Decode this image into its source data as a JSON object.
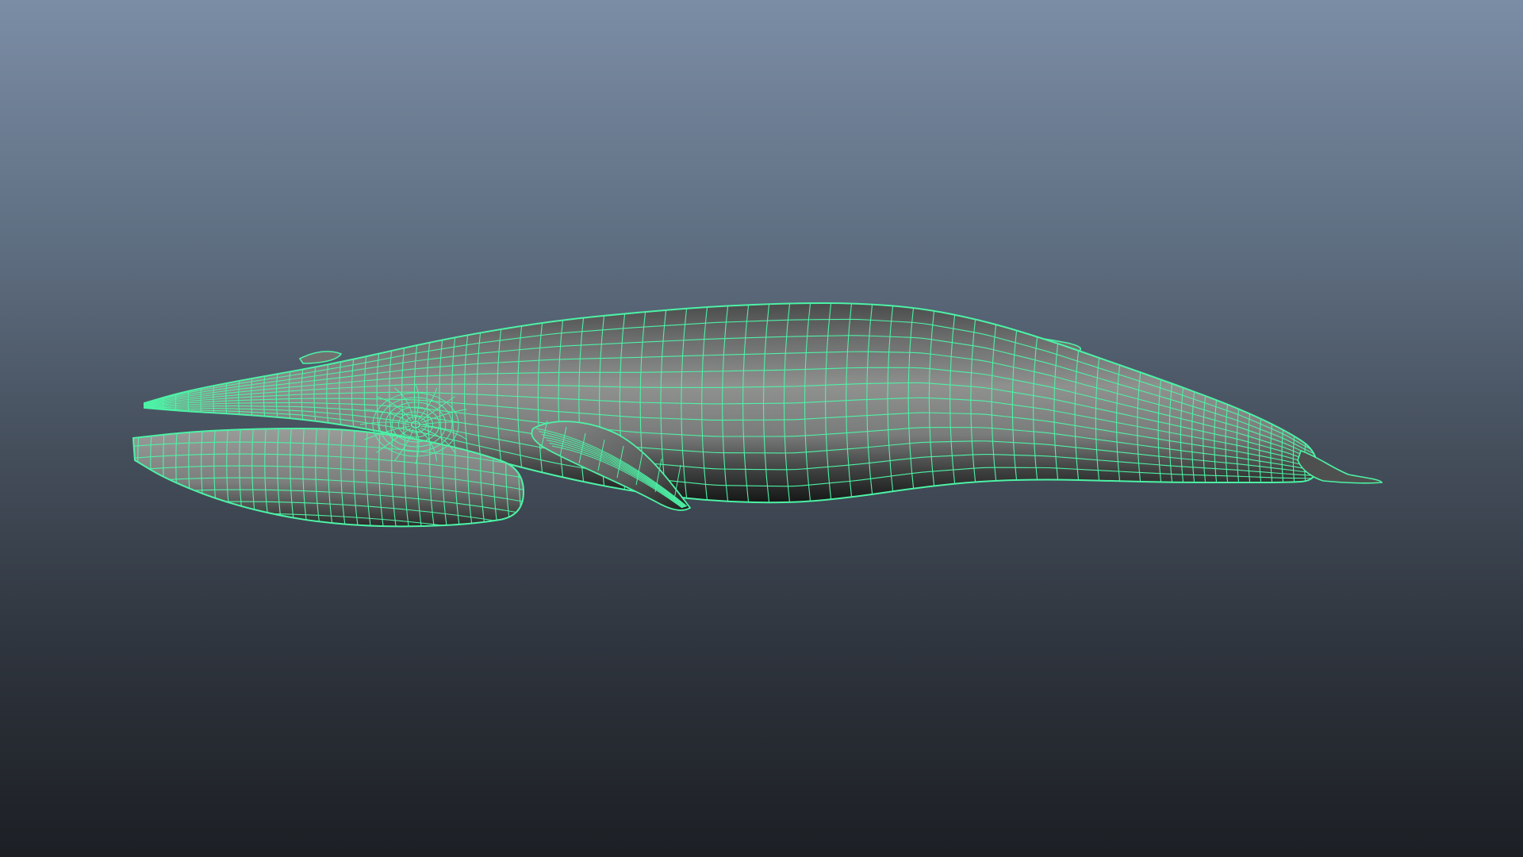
{
  "viewport": {
    "background_top": "#7b8da5",
    "background_bottom": "#1c1f24"
  },
  "model": {
    "subject": "whale",
    "display_mode": "wireframe-on-shaded",
    "selected": true,
    "wire_color": "#4df2a6",
    "shade_light": "#8f918f",
    "shade_mid": "#6c6e6e",
    "shade_dark": "#151716"
  }
}
